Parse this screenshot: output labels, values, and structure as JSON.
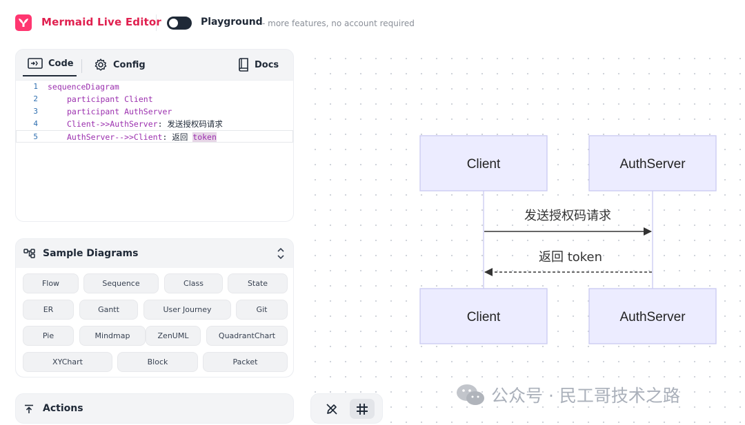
{
  "header": {
    "title": "Mermaid Live Editor",
    "playground_label": "Playground",
    "playground_subtitle": "- more features, no account required"
  },
  "editor": {
    "tabs": {
      "code": "Code",
      "config": "Config",
      "docs": "Docs"
    },
    "line_numbers": [
      "1",
      "2",
      "3",
      "4",
      "5"
    ],
    "lines": {
      "l1": "sequenceDiagram",
      "l2": "participant Client",
      "l3": "participant AuthServer",
      "l4_a": "Client->>AuthServer",
      "l4_b": ": 发送授权码请求",
      "l5_a": "AuthServer-->>Client",
      "l5_b": ": 返回 ",
      "l5_c": "token"
    }
  },
  "samples": {
    "title": "Sample Diagrams",
    "buttons": [
      "Flow",
      "Sequence",
      "Class",
      "State",
      "ER",
      "Gantt",
      "User Journey",
      "Git",
      "Pie",
      "Mindmap",
      "ZenUML",
      "QuadrantChart",
      "XYChart",
      "Block",
      "Packet"
    ]
  },
  "actions": {
    "label": "Actions"
  },
  "diagram": {
    "participants": [
      "Client",
      "AuthServer"
    ],
    "messages": [
      "发送授权码请求",
      "返回 token"
    ],
    "colors": {
      "box_fill": "#ececff",
      "box_stroke": "#c9c9f0",
      "line": "#333333"
    }
  },
  "watermark": {
    "text": "公众号 · 民工哥技术之路"
  },
  "colors": {
    "brand": "#ff3670",
    "brand_text": "#e0204f",
    "keyword": "#9b2fae"
  }
}
